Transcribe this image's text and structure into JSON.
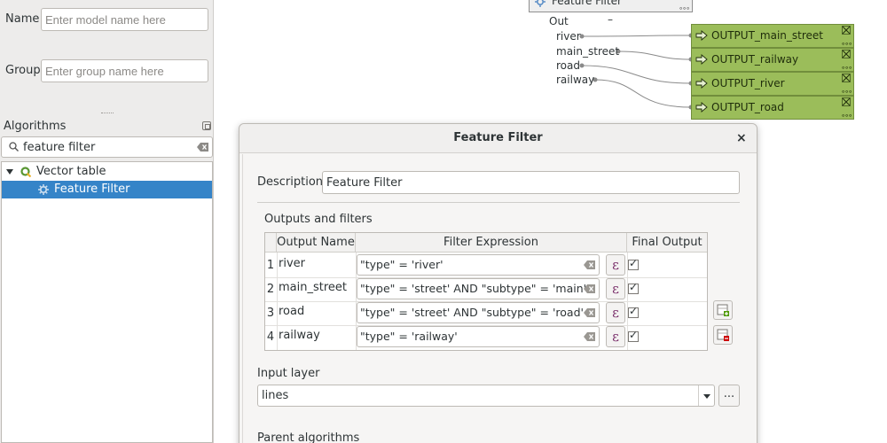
{
  "left_panel": {
    "name_label": "Name",
    "name_placeholder": "Enter model name here",
    "group_label": "Group",
    "group_placeholder": "Enter group name here",
    "algorithms_title": "Algorithms",
    "search_value": "feature filter",
    "tree": [
      {
        "label": "Vector table",
        "icon": "qgis-icon",
        "expanded": true
      },
      {
        "label": "Feature Filter",
        "icon": "gear-icon",
        "selected": true
      }
    ]
  },
  "canvas": {
    "algorithm_node": "Feature Filter",
    "out_label": "Out",
    "out_toggle": "–",
    "ports": [
      "river",
      "main_street",
      "road",
      "railway"
    ],
    "output_nodes": [
      "OUTPUT_main_street",
      "OUTPUT_railway",
      "OUTPUT_river",
      "OUTPUT_road"
    ],
    "node_color": "#9bbd5a"
  },
  "dialog": {
    "title": "Feature Filter",
    "close": "×",
    "description_label": "Description",
    "description_value": "Feature Filter",
    "outputs_label": "Outputs and filters",
    "columns": [
      "Output Name",
      "Filter Expression",
      "Final Output"
    ],
    "rows": [
      {
        "num": "1",
        "name": "river",
        "expression": "\"type\" = 'river'",
        "final": true
      },
      {
        "num": "2",
        "name": "main_street",
        "expression": "\"type\" = 'street' AND \"subtype\" = 'main'",
        "final": true
      },
      {
        "num": "3",
        "name": "road",
        "expression": "\"type\" = 'street' AND \"subtype\" = 'road'",
        "final": true
      },
      {
        "num": "4",
        "name": "railway",
        "expression": "\"type\" = 'railway'",
        "final": true
      }
    ],
    "epsilon": "ε",
    "input_layer_label": "Input layer",
    "input_layer_value": "lines",
    "more_button": "...",
    "parent_algorithms_label": "Parent algorithms"
  }
}
